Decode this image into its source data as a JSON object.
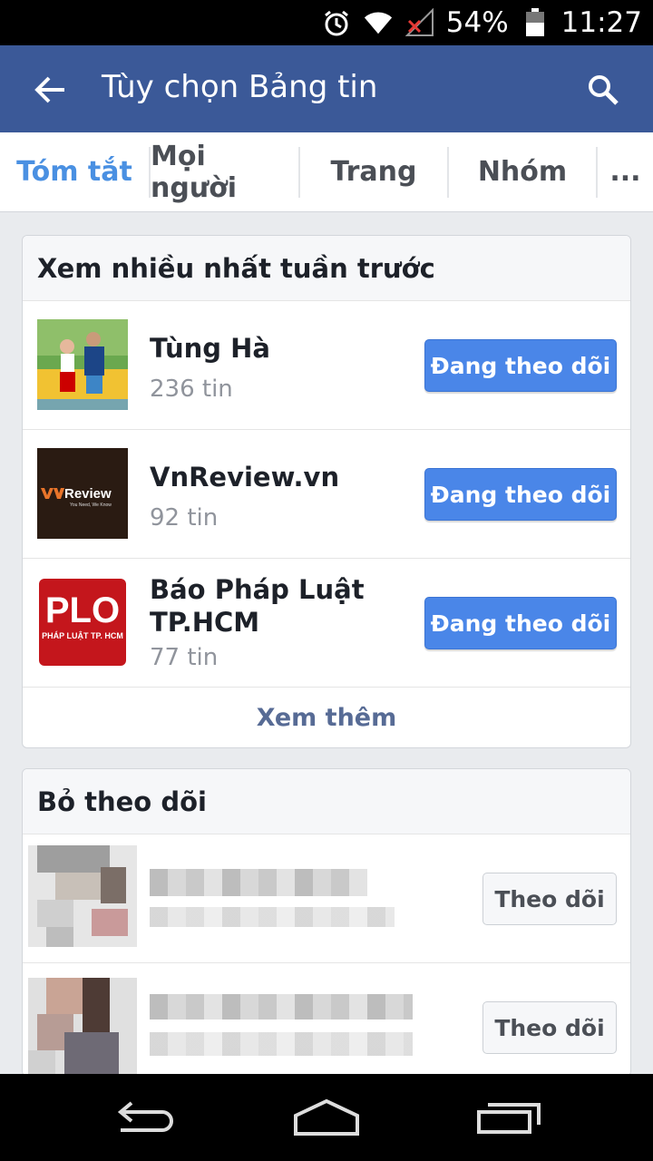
{
  "status_bar": {
    "battery": "54%",
    "time": "11:27",
    "icons": [
      "alarm-icon",
      "wifi-icon",
      "no-signal-icon",
      "battery-icon"
    ]
  },
  "app_bar": {
    "title": "Tùy chọn Bảng tin",
    "back_icon": "back-arrow-icon",
    "search_icon": "search-icon",
    "color": "#3b5998"
  },
  "tabs": [
    {
      "label": "Tóm tắt",
      "active": true
    },
    {
      "label": "Mọi người",
      "active": false
    },
    {
      "label": "Trang",
      "active": false
    },
    {
      "label": "Nhóm",
      "active": false
    },
    {
      "label": "...",
      "active": false
    }
  ],
  "most_viewed": {
    "header": "Xem nhiều nhất tuần trước",
    "items": [
      {
        "name": "Tùng Hà",
        "count": "236 tin",
        "button": "Đang theo dõi"
      },
      {
        "name": "VnReview.vn",
        "count": "92 tin",
        "button": "Đang theo dõi"
      },
      {
        "name": "Báo Pháp Luật TP.HCM",
        "count": "77 tin",
        "button": "Đang theo dõi"
      }
    ],
    "see_more": "Xem thêm",
    "logos": {
      "vnreview_brand": "Review",
      "vnreview_tagline": "You Need, We Know",
      "plo_main": "PLO",
      "plo_sub": "PHÁP LUẬT TP. HCM"
    }
  },
  "unfollowed": {
    "header": "Bỏ theo dõi",
    "items": [
      {
        "button": "Theo dõi"
      },
      {
        "button": "Theo dõi"
      }
    ]
  },
  "colors": {
    "accent_tab": "#4a90e2",
    "follow_button": "#4a86e8",
    "link": "#576b95"
  },
  "nav_bar": {
    "icons": [
      "nav-back-icon",
      "nav-home-icon",
      "nav-recents-icon"
    ]
  }
}
